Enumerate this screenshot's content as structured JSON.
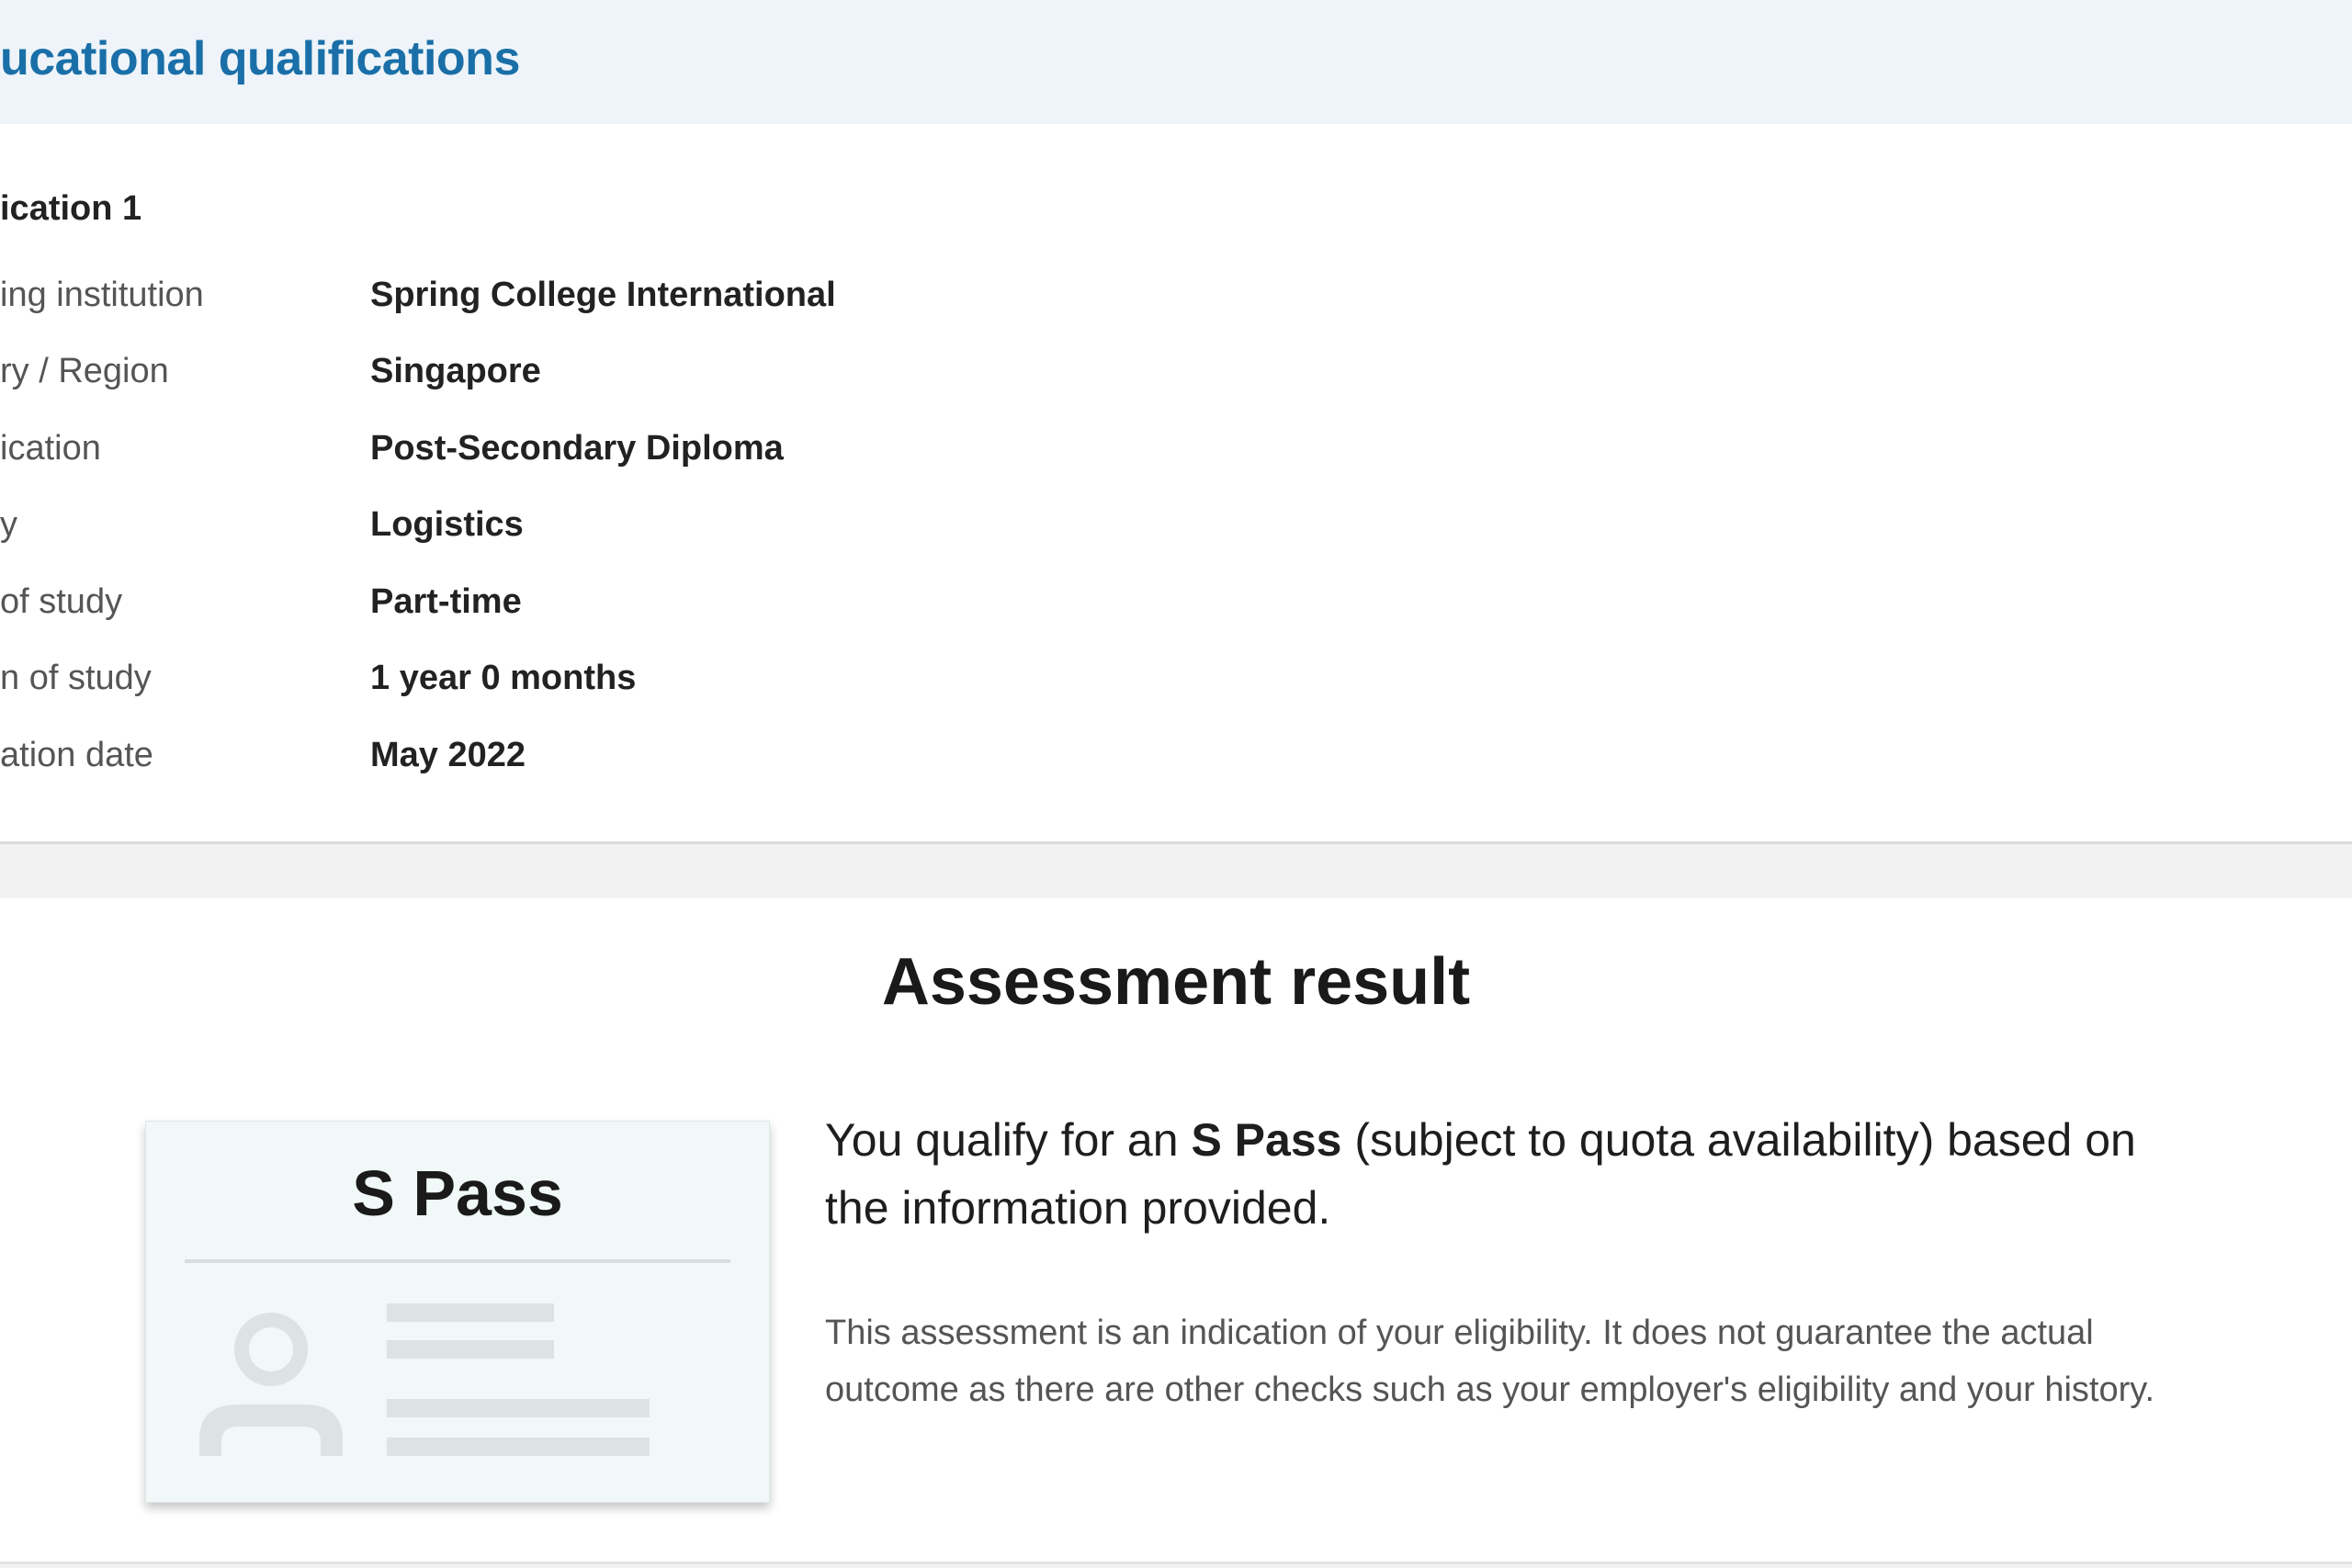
{
  "qualifications_section": {
    "title": "ucational qualifications",
    "qualification_heading": "ication 1",
    "rows": [
      {
        "label": "ing institution",
        "value": "Spring College International"
      },
      {
        "label": "ry / Region",
        "value": "Singapore"
      },
      {
        "label": "ication",
        "value": "Post-Secondary Diploma"
      },
      {
        "label": "y",
        "value": "Logistics"
      },
      {
        "label": "of study",
        "value": "Part-time"
      },
      {
        "label": "n of study",
        "value": "1 year 0 months"
      },
      {
        "label": "ation date",
        "value": "May 2022"
      }
    ]
  },
  "assessment": {
    "title": "Assessment result",
    "pass_card": {
      "pass_name": "S Pass",
      "icon": "person-id-icon"
    },
    "message": {
      "prefix": "You qualify for an ",
      "pass_name": "S Pass",
      "suffix": " (subject to quota availability) based on the information provided."
    },
    "disclaimer": "This assessment is an indication of your eligibility. It does not guarantee the actual outcome as there are other checks such as your employer's eligibility and your history."
  },
  "colors": {
    "accent": "#1a6fa8",
    "header_bg": "#eef4f9",
    "card_bg": "#f1f8f8"
  }
}
